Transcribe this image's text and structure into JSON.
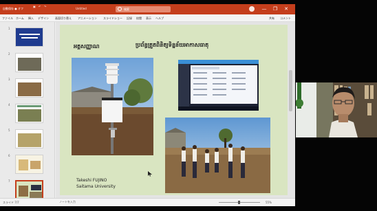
{
  "window": {
    "app_name": "自動保存 ● オフ",
    "doc_title": "Untitled",
    "search_text": "検索",
    "controls": [
      "—",
      "❐",
      "✕"
    ]
  },
  "menu": {
    "items": [
      "ファイル",
      "ホーム",
      "挿入",
      "デザイン",
      "画面切り替え",
      "アニメーション",
      "スライドショー",
      "記録",
      "校閲",
      "表示",
      "ヘルプ"
    ],
    "share_label": "共有",
    "comment_label": "コメント"
  },
  "thumbnails": {
    "numbers": [
      "1",
      "2",
      "3",
      "4",
      "5",
      "6",
      "7"
    ],
    "selected_index": 7
  },
  "slide": {
    "heading": "អត្តសញ្ញាណ",
    "subtitle": "ប្រព័ន្ធត្រួតពិនិត្យទិន្នន័យអាកាសធាតុ",
    "presenter_name": "Takeshi FUJINO",
    "presenter_affiliation": "Saitama University"
  },
  "status": {
    "slide_counter": "スライド 7/7",
    "notes_placeholder": "ノートを入力",
    "zoom_level": "55%"
  },
  "colors": {
    "ribbon": "#c43e1c",
    "slide_background": "#d9e5c1"
  }
}
